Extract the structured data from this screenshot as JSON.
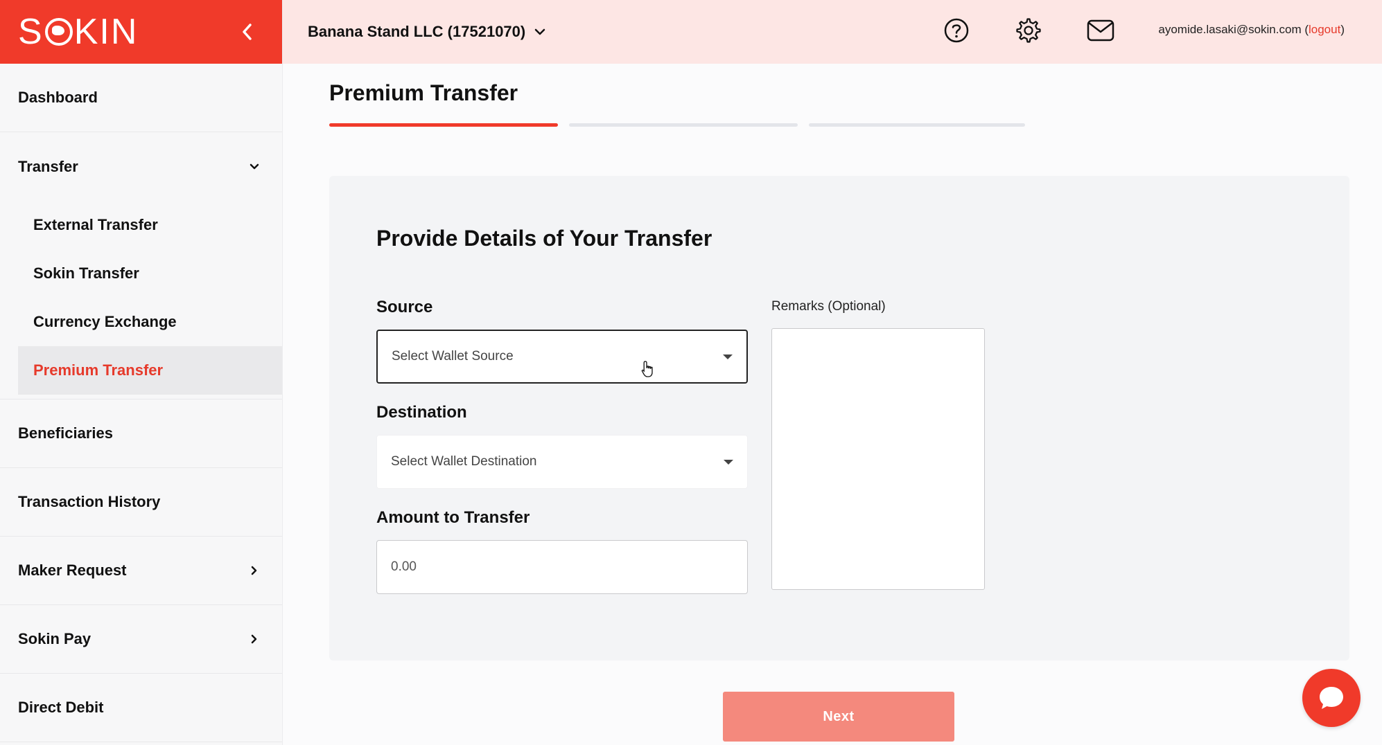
{
  "brand": {
    "logo_text_pre": "S",
    "logo_text_post": "KIN",
    "accent": "#f03a2a"
  },
  "header": {
    "company": "Banana Stand LLC (17521070)",
    "icons": [
      "help-icon",
      "gear-icon",
      "mail-icon"
    ],
    "user_email": "ayomide.lasaki@sokin.com",
    "logout_open": " (",
    "logout_label": "logout",
    "logout_close": ")"
  },
  "sidebar": {
    "items": [
      {
        "label": "Dashboard"
      },
      {
        "label": "Transfer"
      },
      {
        "label": "Beneficiaries"
      },
      {
        "label": "Transaction History"
      },
      {
        "label": "Maker Request"
      },
      {
        "label": "Sokin Pay"
      },
      {
        "label": "Direct Debit"
      }
    ],
    "transfer_sub": [
      {
        "label": "External Transfer"
      },
      {
        "label": "Sokin Transfer"
      },
      {
        "label": "Currency Exchange"
      },
      {
        "label": "Premium Transfer"
      }
    ]
  },
  "main": {
    "page_title": "Premium Transfer",
    "steps": [
      {
        "state": "active"
      },
      {
        "state": "inactive"
      },
      {
        "state": "inactive"
      }
    ],
    "card_title": "Provide Details of Your Transfer",
    "source_label": "Source",
    "source_placeholder": "Select Wallet Source",
    "destination_label": "Destination",
    "destination_placeholder": "Select Wallet Destination",
    "amount_label": "Amount to Transfer",
    "amount_value": "0.00",
    "remarks_label": "Remarks (Optional)",
    "next_label": "Next"
  }
}
